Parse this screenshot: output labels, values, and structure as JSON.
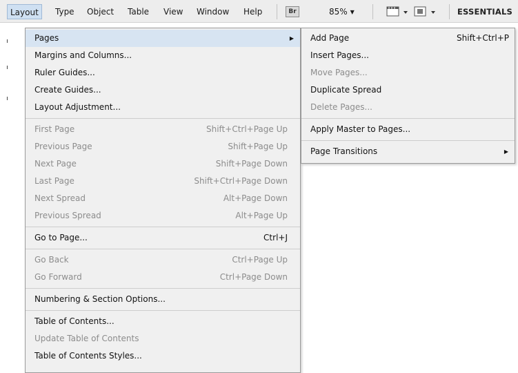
{
  "menubar": {
    "items": [
      "Layout",
      "Type",
      "Object",
      "Table",
      "View",
      "Window",
      "Help"
    ],
    "bridge_label": "Br",
    "zoom": "85%",
    "workspace": "ESSENTIALS"
  },
  "layout_menu": {
    "pages": "Pages",
    "margins": "Margins and Columns...",
    "ruler_guides": "Ruler Guides...",
    "create_guides": "Create Guides...",
    "layout_adjustment": "Layout Adjustment...",
    "first_page": {
      "label": "First Page",
      "shortcut": "Shift+Ctrl+Page Up"
    },
    "previous_page": {
      "label": "Previous Page",
      "shortcut": "Shift+Page Up"
    },
    "next_page": {
      "label": "Next Page",
      "shortcut": "Shift+Page Down"
    },
    "last_page": {
      "label": "Last Page",
      "shortcut": "Shift+Ctrl+Page Down"
    },
    "next_spread": {
      "label": "Next Spread",
      "shortcut": "Alt+Page Down"
    },
    "previous_spread": {
      "label": "Previous Spread",
      "shortcut": "Alt+Page Up"
    },
    "go_to_page": {
      "label": "Go to Page...",
      "shortcut": "Ctrl+J"
    },
    "go_back": {
      "label": "Go Back",
      "shortcut": "Ctrl+Page Up"
    },
    "go_forward": {
      "label": "Go Forward",
      "shortcut": "Ctrl+Page Down"
    },
    "numbering": "Numbering & Section Options...",
    "toc": "Table of Contents...",
    "update_toc": "Update Table of Contents",
    "toc_styles": "Table of Contents Styles..."
  },
  "pages_submenu": {
    "add_page": {
      "label": "Add Page",
      "shortcut": "Shift+Ctrl+P"
    },
    "insert_pages": "Insert Pages...",
    "move_pages": "Move Pages...",
    "duplicate_spread": "Duplicate Spread",
    "delete_pages": "Delete Pages...",
    "apply_master": "Apply Master to Pages...",
    "page_transitions": "Page Transitions"
  },
  "colors": {
    "menu_bg": "#f0f0f0",
    "highlight": "#d7e4f2",
    "disabled_text": "#8c8c8c"
  }
}
